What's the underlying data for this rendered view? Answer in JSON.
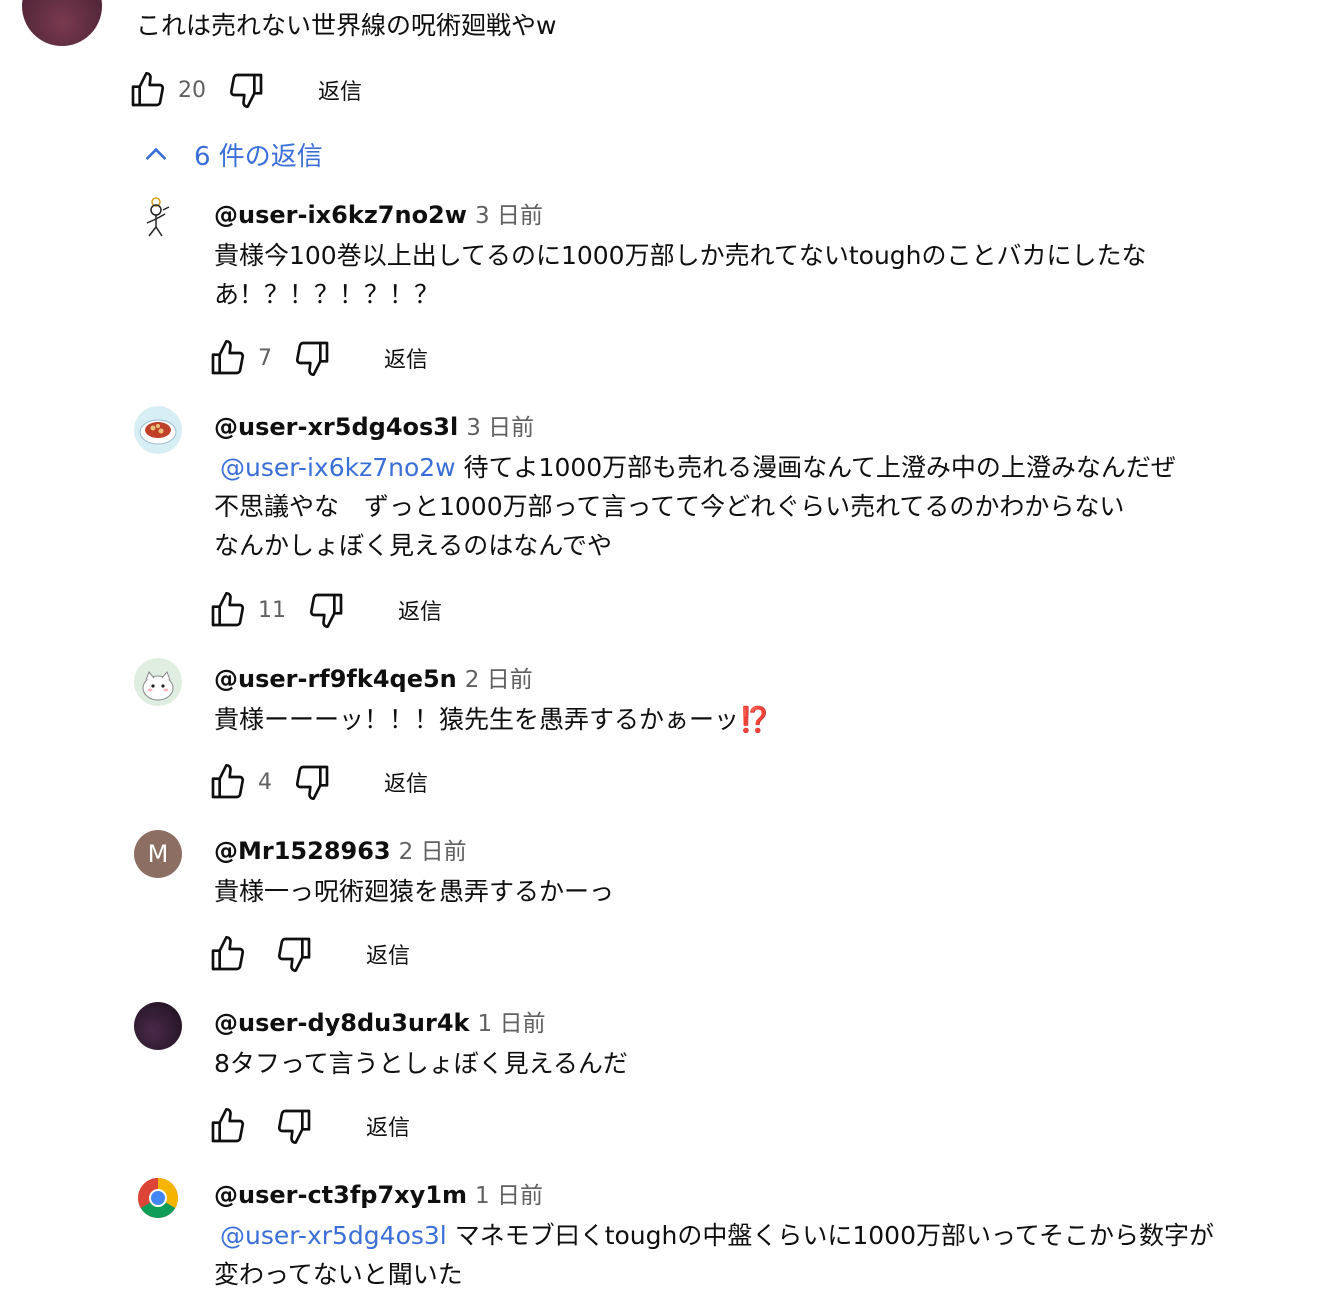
{
  "top_comment": {
    "text": "これは売れない世界線の呪術廻戦やw",
    "likes": "20",
    "reply_label": "返信"
  },
  "replies_toggle": {
    "label": "6 件の返信"
  },
  "replies": [
    {
      "handle": "@user-ix6kz7no2w",
      "time": "3 日前",
      "mention": "",
      "lines": [
        "貴様今100巻以上出してるのに1000万部しか売れてないtoughのことバカにしたな",
        "あ！？！？！？！？"
      ],
      "likes": "7",
      "reply_label": "返信"
    },
    {
      "handle": "@user-xr5dg4os3l",
      "time": "3 日前",
      "mention": "@user-ix6kz7no2w",
      "lines": [
        " 待てよ1000万部も売れる漫画なんて上澄み中の上澄みなんだぜ",
        "不思議やな　ずっと1000万部って言ってて今どれぐらい売れてるのかわからない",
        "なんかしょぼく見えるのはなんでや"
      ],
      "likes": "11",
      "reply_label": "返信"
    },
    {
      "handle": "@user-rf9fk4qe5n",
      "time": "2 日前",
      "mention": "",
      "lines": [
        "貴様ーーーッ！！！猿先生を愚弄するかぁーッ⁉️"
      ],
      "likes": "4",
      "reply_label": "返信"
    },
    {
      "handle": "@Mr1528963",
      "time": "2 日前",
      "avatar_letter": "M",
      "mention": "",
      "lines": [
        "貴様一っ呪術廻猿を愚弄するかーっ"
      ],
      "likes": "",
      "reply_label": "返信"
    },
    {
      "handle": "@user-dy8du3ur4k",
      "time": "1 日前",
      "mention": "",
      "lines": [
        "8タフって言うとしょぼく見えるんだ"
      ],
      "likes": "",
      "reply_label": "返信"
    },
    {
      "handle": "@user-ct3fp7xy1m",
      "time": "1 日前",
      "mention": "@user-xr5dg4os3l",
      "lines": [
        " マネモブ曰くtoughの中盤くらいに1000万部いってそこから数字が",
        "変わってないと聞いた"
      ],
      "likes": "",
      "reply_label": ""
    }
  ],
  "colors": {
    "link": "#3b6fd8",
    "meta": "#606060",
    "avatar_m": "#8d6e63"
  },
  "icons": {
    "like": "thumbs-up-icon",
    "dislike": "thumbs-down-icon",
    "collapse": "chevron-up-icon"
  }
}
